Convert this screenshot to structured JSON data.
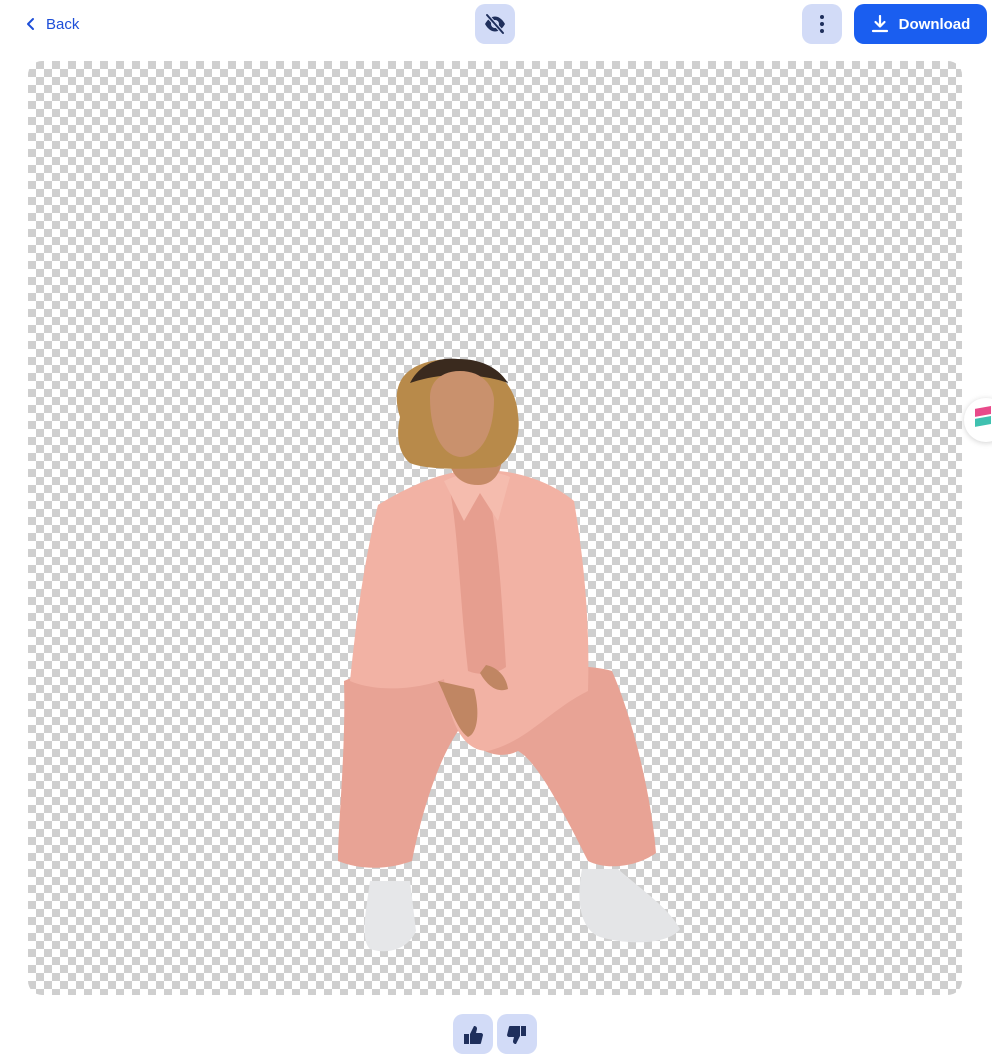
{
  "toolbar": {
    "back_label": "Back",
    "download_label": "Download",
    "toggle_icon": "eye-slash-icon",
    "more_icon": "more-vertical-icon",
    "download_icon": "download-icon"
  },
  "feedback": {
    "like_icon": "thumbs-up-icon",
    "dislike_icon": "thumbs-down-icon"
  },
  "colors": {
    "accent": "#1a5ef0",
    "link": "#1d4ed8",
    "soft_button": "#d2dbf7",
    "checker_dark": "#cfcfcf",
    "checker_light": "#ffffff"
  }
}
